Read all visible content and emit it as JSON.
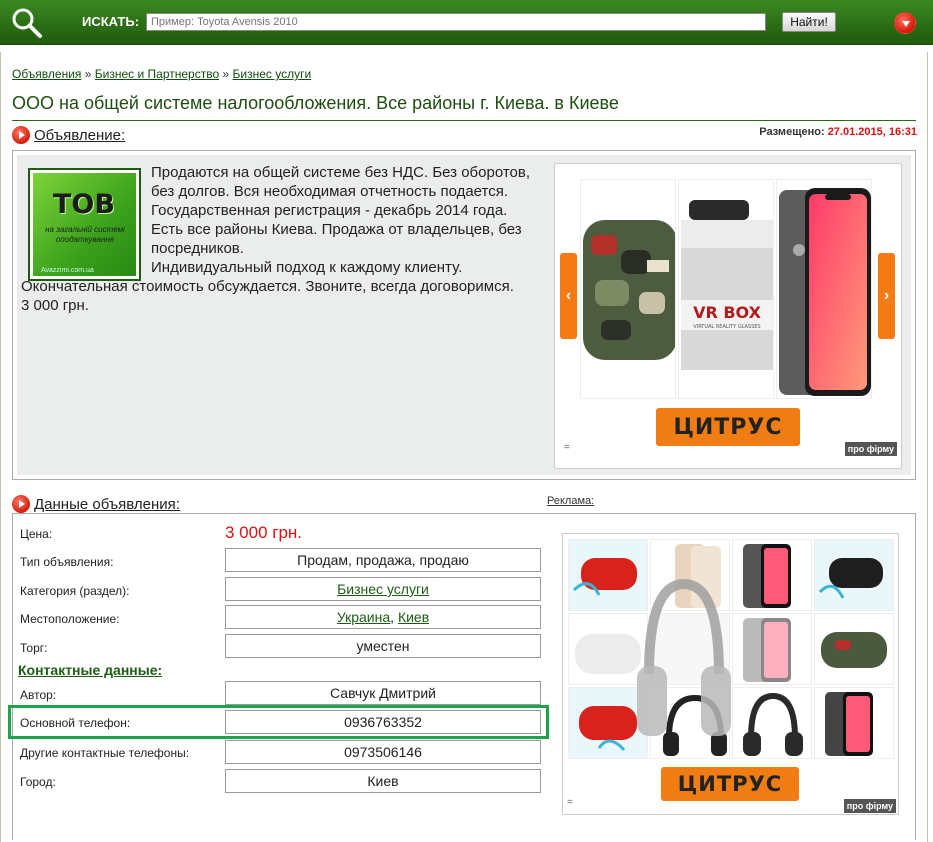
{
  "search": {
    "label": "ИСКАТЬ:",
    "placeholder": "Пример: Toyota Avensis 2010",
    "button": "Найти!"
  },
  "breadcrumb": {
    "items": [
      "Объявления",
      "Бизнес и Партнерство",
      "Бизнес услуги"
    ],
    "sep": "»"
  },
  "title": "ООО на общей системе налогообложения. Все районы г. Киева. в Киеве",
  "ad_section": {
    "heading": "Объявление:",
    "posted_label": "Размещено:",
    "posted_date": "27.01.2015, 16:31",
    "logo_text": "ТОВ",
    "logo_sub": "на загальній системі оподаткування",
    "logo_watermark": "Avazzimi.com.ua",
    "lines": [
      "Продаются на общей системе без НДС. Без оборотов, без долгов. Вся необходимая отчетность подается.",
      "Государственная регистрация - декабрь 2014 года.",
      "Есть все районы Киева. Продажа от владельцев, без посредников.",
      "Индивидуальный подход к каждому клиенту.",
      "Окончательная стоимость обсуждается. Звоните, всегда договоримся.",
      "3 000 грн."
    ]
  },
  "banner": {
    "brand": "ЦИТРУС",
    "pro": "про фірму",
    "eq": "=",
    "vrbox": "VR BOX",
    "vrbox_sub": "VIRTUAL REALITY GLASSES",
    "arrow_left": "‹",
    "arrow_right": "›"
  },
  "data_section": {
    "heading": "Данные объявления:",
    "ads_label": "Реклама:",
    "price_label": "Цена:",
    "price": "3 000 грн.",
    "type_label": "Тип объявления:",
    "type": "Продам, продажа, продаю",
    "category_label": "Категория (раздел):",
    "category": "Бизнес услуги",
    "location_label": "Местоположение:",
    "location_country": "Украина",
    "location_sep": ", ",
    "location_city": "Киев",
    "bargain_label": "Торг:",
    "bargain": "уместен",
    "contacts_heading": "Контактные данные:",
    "author_label": "Автор:",
    "author": "Савчук Дмитрий",
    "phone_label": "Основной телефон:",
    "phone": "0936763352",
    "other_phones_label": "Другие контактные телефоны:",
    "other_phones": "0973506146",
    "city_label": "Город:",
    "city": "Киев"
  },
  "colors": {
    "topbar": "#2a6d14",
    "accent_red": "#d11111",
    "link_green": "#1b5e12",
    "highlight_green": "#22a04a",
    "citrus_orange": "#f07d13"
  }
}
